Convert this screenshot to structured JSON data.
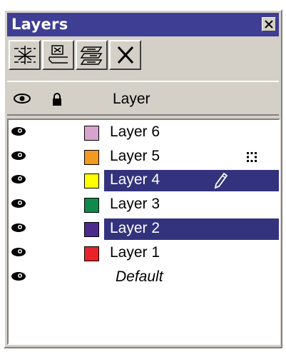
{
  "window": {
    "title": "Layers"
  },
  "header": {
    "layer_label": "Layer"
  },
  "toolbar": {
    "buttons": [
      {
        "icon": "new-layer-icon"
      },
      {
        "icon": "new-master-layer-icon"
      },
      {
        "icon": "layer-properties-icon"
      },
      {
        "icon": "delete-layer-icon"
      }
    ]
  },
  "layers": [
    {
      "name": "Layer 6",
      "color": "#d8a3cd",
      "visible": true,
      "selected": false
    },
    {
      "name": "Layer 5",
      "color": "#f29a1f",
      "visible": true,
      "selected": false,
      "indicator": "grid-dots-icon"
    },
    {
      "name": "Layer 4",
      "color": "#ffff00",
      "visible": true,
      "selected": true,
      "indicator": "pencil-icon"
    },
    {
      "name": "Layer 3",
      "color": "#0e8a4b",
      "visible": true,
      "selected": false
    },
    {
      "name": "Layer 2",
      "color": "#4b2a8e",
      "visible": true,
      "selected": true
    },
    {
      "name": "Layer 1",
      "color": "#e8242a",
      "visible": true,
      "selected": false
    },
    {
      "name": "Default",
      "visible": true,
      "selected": false,
      "italic": true
    }
  ]
}
